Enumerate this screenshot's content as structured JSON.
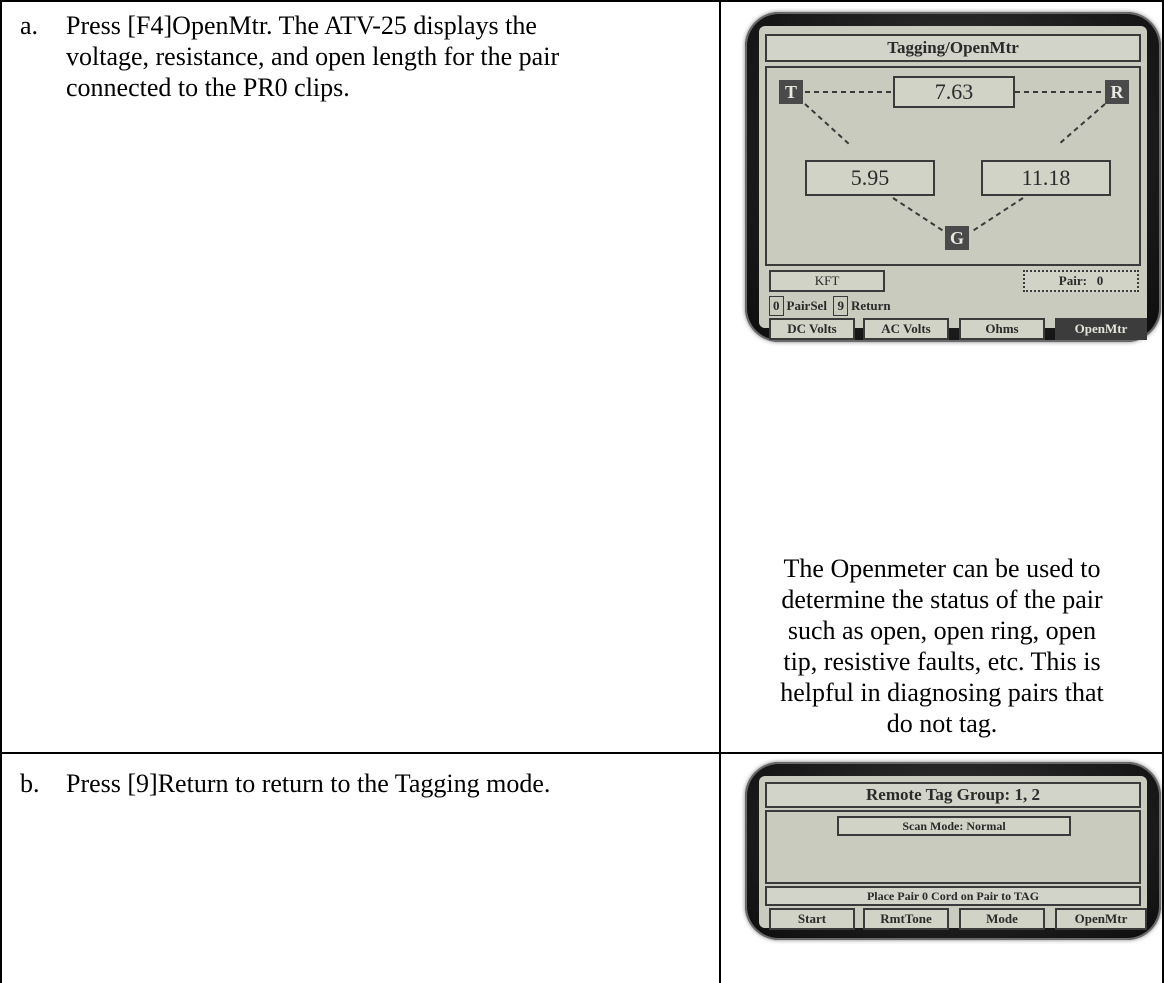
{
  "steps": [
    {
      "letter": "a.",
      "lines": [
        "Press [F4]OpenMtr. The ATV-25 displays the",
        "voltage, resistance, and open length for the pair",
        "connected to the PR0 clips."
      ],
      "caption_lines": [
        "The Openmeter can be used to",
        "determine the status of the pair",
        "such as open, open ring, open",
        "tip, resistive faults, etc. This is",
        "helpful in diagnosing pairs that",
        "do not tag."
      ]
    },
    {
      "letter": "b.",
      "lines": [
        "Press [9]Return to return to the Tagging mode."
      ]
    }
  ],
  "screen1": {
    "title": "Tagging/OpenMtr",
    "tip_label": "T",
    "ring_label": "R",
    "ground_label": "G",
    "tip_ring_value": "7.63",
    "tip_ground_value": "5.95",
    "ring_ground_value": "11.18",
    "unit": "KFT",
    "pair_label": "Pair:",
    "pair_value": "0",
    "key0": "0",
    "key0_label": "PairSel",
    "key9": "9",
    "key9_label": "Return",
    "fkeys": [
      "DC Volts",
      "AC Volts",
      "Ohms",
      "OpenMtr"
    ],
    "active_fkey": "OpenMtr"
  },
  "screen2": {
    "title": "Remote Tag Group: 1, 2",
    "scan_mode": "Scan Mode: Normal",
    "status": "Place Pair 0 Cord on Pair to TAG",
    "fkeys": [
      "Start",
      "RmtTone",
      "Mode",
      "OpenMtr"
    ]
  },
  "colors": {
    "lcd_background": "#c8cbbd",
    "lcd_ink": "#2a2a2a",
    "device_bezel": "#1f1f1f",
    "active_key": "#3c3c3c"
  }
}
